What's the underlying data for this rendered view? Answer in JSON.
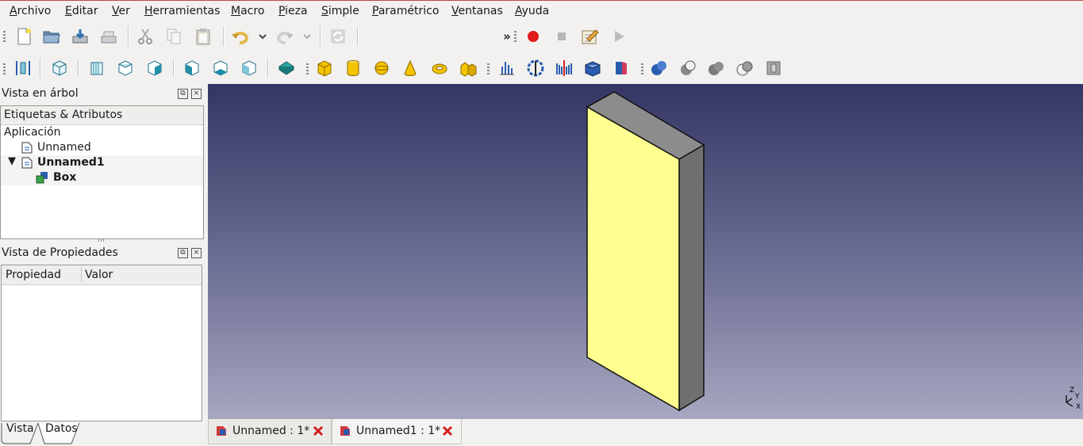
{
  "menubar": {
    "items": [
      {
        "label": "Archivo",
        "access": "A",
        "rest": "rchivo"
      },
      {
        "label": "Editar",
        "access": "E",
        "rest": "ditar"
      },
      {
        "label": "Ver",
        "access": "V",
        "rest": "er"
      },
      {
        "label": "Herramientas",
        "access": "H",
        "rest": "erramientas"
      },
      {
        "label": "Macro",
        "access": "M",
        "rest": "acro"
      },
      {
        "label": "Pieza",
        "access": "P",
        "rest": "ieza"
      },
      {
        "label": "Simple",
        "access": "S",
        "rest": "imple"
      },
      {
        "label": "Paramétrico",
        "access": "P",
        "rest": "aramétrico"
      },
      {
        "label": "Ventanas",
        "access": "V",
        "rest": "entanas"
      },
      {
        "label": "Ayuda",
        "access": "A",
        "rest": "yuda"
      }
    ]
  },
  "toolbar": {
    "overflow_label": "»",
    "colors": {
      "record": "#e01b1b",
      "part_yellow": "#f5c400",
      "blue": "#2a5db0",
      "teal": "#1f8fa8"
    }
  },
  "tree_view": {
    "title": "Vista en árbol",
    "header": "Etiquetas & Atributos",
    "root": "Aplicación",
    "items": [
      {
        "label": "Unnamed",
        "bold": false
      },
      {
        "label": "Unnamed1",
        "bold": true,
        "expanded": true
      },
      {
        "label": "Box",
        "bold": true
      }
    ]
  },
  "property_view": {
    "title": "Vista de Propiedades",
    "columns": [
      "Propiedad",
      "Valor"
    ],
    "tabs": [
      "Vista",
      "Datos"
    ],
    "active_tab": "Datos"
  },
  "viewer": {
    "axis_labels": {
      "z": "Z",
      "y": "Y",
      "x": "X"
    },
    "colors": {
      "face_front": "#ffff8f",
      "face_top": "#8c8c8c",
      "face_side": "#707070",
      "bg_top": "#343564",
      "bg_bottom": "#a7a7c0"
    }
  },
  "documents": {
    "tabs": [
      {
        "label": "Unnamed : 1*",
        "active": false
      },
      {
        "label": "Unnamed1 : 1*",
        "active": true
      }
    ]
  }
}
